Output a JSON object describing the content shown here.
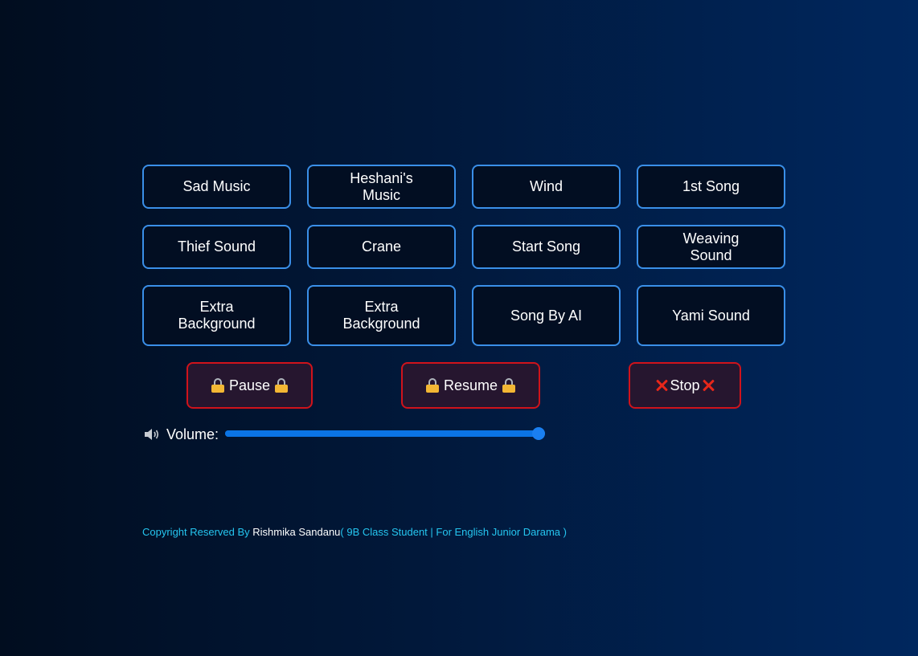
{
  "sound_buttons": [
    {
      "label": "Sad Music"
    },
    {
      "label": "Heshani's Music"
    },
    {
      "label": "Wind"
    },
    {
      "label": "1st Song"
    },
    {
      "label": "Thief Sound"
    },
    {
      "label": "Crane"
    },
    {
      "label": "Start Song"
    },
    {
      "label": "Weaving Sound"
    },
    {
      "label": "Extra Background"
    },
    {
      "label": "Extra Background"
    },
    {
      "label": "Song By AI"
    },
    {
      "label": "Yami Sound"
    }
  ],
  "controls": {
    "pause_label": "Pause",
    "resume_label": "Resume",
    "stop_label": "Stop",
    "pause_icon": "lock-icon",
    "resume_icon": "lock-icon",
    "stop_icon": "cross-mark-icon"
  },
  "volume": {
    "label": "Volume:",
    "icon": "speaker-icon",
    "value": 1.0
  },
  "footer": {
    "prefix": "Copyright Reserved By ",
    "name": "Rishmika Sandanu",
    "suffix": "( 9B Class Student | For English Junior Darama )"
  },
  "colors": {
    "button_border": "#3a8fe8",
    "control_border": "#d0131b",
    "slider": "#0b74e5",
    "footer_text": "#25c6f0"
  }
}
